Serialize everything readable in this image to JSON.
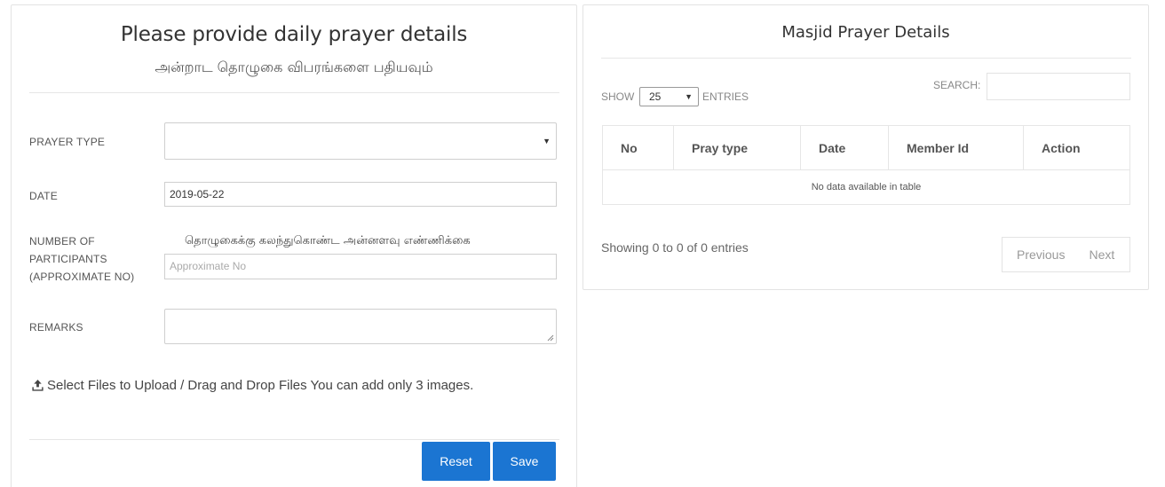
{
  "form": {
    "title": "Please provide daily prayer details",
    "subtitle_tamil": "அன்றாட தொழுகை விபரங்களை பதியவும்",
    "fields": {
      "prayer_type": {
        "label": "PRAYER TYPE",
        "value": ""
      },
      "date": {
        "label": "DATE",
        "value": "2019-05-22"
      },
      "participants": {
        "label_line1": "NUMBER OF",
        "label_line2": "PARTICIPANTS",
        "label_line3": "(APPROXIMATE NO)",
        "hint_tamil": "தொழுகைக்கு கலந்துகொண்ட அன்னளவு எண்ணிக்கை",
        "placeholder": "Approximate No"
      },
      "remarks": {
        "label": "REMARKS",
        "value": ""
      }
    },
    "upload_text": "Select Files to Upload / Drag and Drop Files You can add only 3 images.",
    "reset_label": "Reset",
    "save_label": "Save",
    "colors": {
      "primary": "#1b75d2"
    }
  },
  "table_panel": {
    "title": "Masjid Prayer Details",
    "show_label": "SHOW",
    "entries_value": "25",
    "entries_label": "ENTRIES",
    "search_label": "SEARCH:",
    "columns": [
      "No",
      "Pray type",
      "Date",
      "Member Id",
      "Action"
    ],
    "empty_message": "No data available in table",
    "info": "Showing 0 to 0 of 0 entries",
    "prev_label": "Previous",
    "next_label": "Next"
  }
}
